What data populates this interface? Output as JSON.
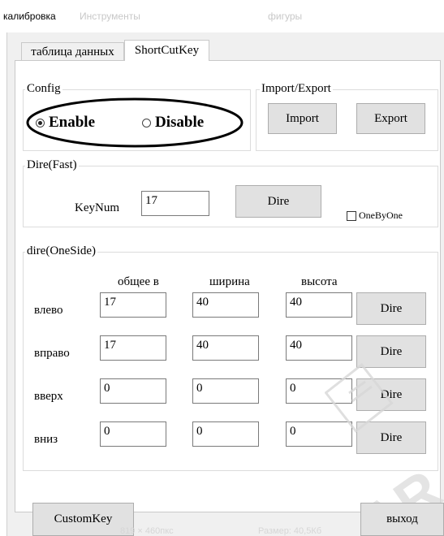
{
  "window": {
    "title": "калибровка",
    "ghost_title_1": "Инструменты",
    "ghost_title_2": "фигуры"
  },
  "tabs": [
    {
      "label": "таблица данных",
      "active": false
    },
    {
      "label": "ShortCutKey",
      "active": true
    }
  ],
  "config": {
    "group_label": "Config",
    "enable_label": "Enable",
    "disable_label": "Disable",
    "selected": "Enable"
  },
  "import_export": {
    "group_label": "Import/Export",
    "import_label": "Import",
    "export_label": "Export"
  },
  "dire_fast": {
    "group_label": "Dire(Fast)",
    "keynum_label": "KeyNum",
    "keynum_value": "17",
    "dire_label": "Dire",
    "onebyone_label": "OneByOne",
    "onebyone_checked": false
  },
  "dire_oneside": {
    "group_label": "dire(OneSide)",
    "columns": [
      "общее в",
      "ширина",
      "высота"
    ],
    "rows": [
      {
        "label": "влево",
        "values": [
          "17",
          "40",
          "40"
        ],
        "button": "Dire"
      },
      {
        "label": "вправо",
        "values": [
          "17",
          "40",
          "40"
        ],
        "button": "Dire"
      },
      {
        "label": "вверх",
        "values": [
          "0",
          "0",
          "0"
        ],
        "button": "Dire"
      },
      {
        "label": "вниз",
        "values": [
          "0",
          "0",
          "0"
        ],
        "button": "Dire"
      }
    ]
  },
  "footer": {
    "custom_key_label": "CustomKey",
    "exit_label": "выход",
    "ghost_size_text": "819 × 460пкс",
    "ghost_file_text": "Размер: 40,5Кб"
  },
  "colors": {
    "panel_bg": "#ffffff",
    "client_bg": "#f0f0f0",
    "button_bg": "#e1e1e1",
    "annotation_ellipse": "#000000"
  }
}
